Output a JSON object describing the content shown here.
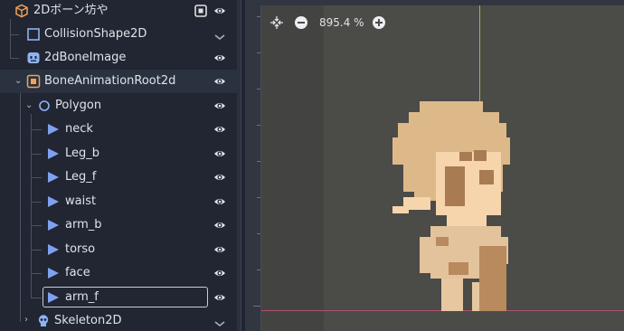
{
  "scene_tree": {
    "nodes": [
      {
        "label": "2Dボーン坊や",
        "icon": "node3d-icon"
      },
      {
        "label": "CollisionShape2D",
        "icon": "collision-shape-icon"
      },
      {
        "label": "2dBoneImage",
        "icon": "sprite-icon"
      },
      {
        "label": "BoneAnimationRoot2d",
        "icon": "scene-instance-icon"
      },
      {
        "label": "Polygon",
        "icon": "polygon-icon"
      },
      {
        "label": "neck",
        "icon": "bone-icon"
      },
      {
        "label": "Leg_b",
        "icon": "bone-icon"
      },
      {
        "label": "Leg_f",
        "icon": "bone-icon"
      },
      {
        "label": "waist",
        "icon": "bone-icon"
      },
      {
        "label": "arm_b",
        "icon": "bone-icon"
      },
      {
        "label": "torso",
        "icon": "bone-icon"
      },
      {
        "label": "face",
        "icon": "bone-icon"
      },
      {
        "label": "arm_f",
        "icon": "bone-icon"
      },
      {
        "label": "Skeleton2D",
        "icon": "skeleton-icon"
      }
    ]
  },
  "viewport": {
    "zoom_label": "895.4 %"
  },
  "colors": {
    "accent": "#8eb3f4",
    "bone": "#7fa2ef",
    "x_axis": "#b24e72",
    "y_axis": "#9bb64a"
  }
}
